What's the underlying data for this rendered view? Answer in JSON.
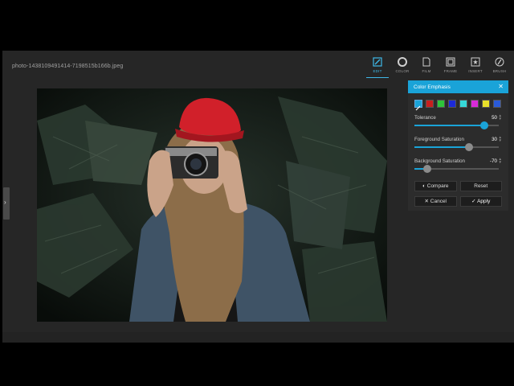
{
  "file": {
    "name": "photo-1438109491414-7198515b166b.jpeg"
  },
  "toolbar": {
    "tools": [
      {
        "label": "EDIT",
        "icon": "edit-icon",
        "active": true
      },
      {
        "label": "COLOR",
        "icon": "color-icon",
        "active": false
      },
      {
        "label": "FILM",
        "icon": "film-icon",
        "active": false
      },
      {
        "label": "FRAME",
        "icon": "frame-icon",
        "active": false
      },
      {
        "label": "INSERT",
        "icon": "insert-icon",
        "active": false
      },
      {
        "label": "BRUSH",
        "icon": "brush-icon",
        "active": false
      }
    ]
  },
  "panel": {
    "title": "Color Emphasis",
    "close_glyph": "✕",
    "swatches": [
      "#c81e1e",
      "#2ec43a",
      "#1c2ad8",
      "#36d8d8",
      "#d82ad8",
      "#e8e02a",
      "#2a5ad8"
    ],
    "params": [
      {
        "name": "Tolerance",
        "value": "50",
        "level": 0.83,
        "active": true
      },
      {
        "name": "Foreground Saturation",
        "value": "30",
        "level": 0.65,
        "active": false
      },
      {
        "name": "Background Saturation",
        "value": "-70",
        "level": 0.15,
        "active": false
      }
    ],
    "compare_label": "Compare",
    "reset_label": "Reset",
    "cancel_label": "Cancel",
    "apply_label": "Apply"
  },
  "colors": {
    "accent": "#1aa3d8",
    "background": "#262626",
    "panel": "#2c2c2c"
  }
}
